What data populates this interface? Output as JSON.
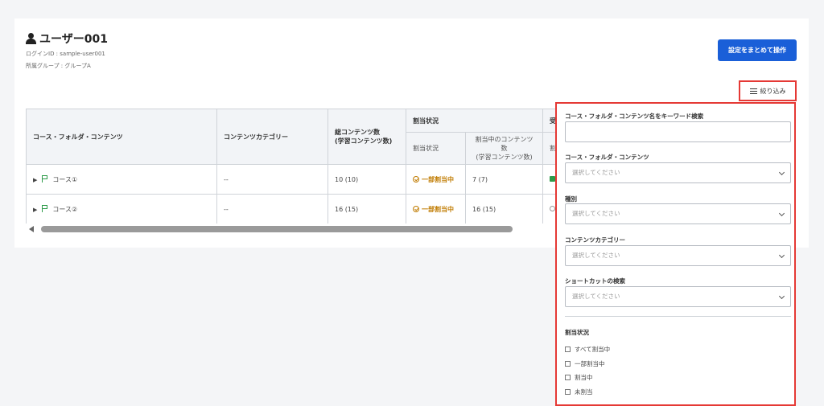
{
  "user": {
    "name": "ユーザー001",
    "login_id": "ログインID : sample-user001",
    "group": "所属グループ : グループA"
  },
  "actions": {
    "bulk_button": "設定をまとめて操作",
    "filter_button": "絞り込み"
  },
  "table": {
    "headers": {
      "course": "コース・フォルダ・コンテンツ",
      "category": "コンテンツカテゴリー",
      "total_line1": "総コンテンツ数",
      "total_line2": "(学習コンテンツ数)",
      "assign_group": "割当状況",
      "assign_status": "割当状況",
      "assigned_line1": "割当中のコンテンツ数",
      "assigned_line2": "(学習コンテンツ数)",
      "next_group": "受",
      "next_sub": "割"
    },
    "rows": [
      {
        "name": "コース①",
        "category": "--",
        "total": "10 (10)",
        "status": "一部割当中",
        "assigned": "7 (7)"
      },
      {
        "name": "コース②",
        "category": "--",
        "total": "16 (15)",
        "status": "一部割当中",
        "assigned": "16 (15)"
      }
    ]
  },
  "filter_panel": {
    "keyword_label": "コース・フォルダ・コンテンツ名をキーワード検索",
    "keyword_value": "",
    "course_label": "コース・フォルダ・コンテンツ",
    "course_placeholder": "選択してください",
    "type_label": "種別",
    "type_placeholder": "選択してください",
    "category_label": "コンテンツカテゴリー",
    "category_placeholder": "選択してください",
    "shortcut_label": "ショートカットの検索",
    "shortcut_placeholder": "選択してください",
    "assign_label": "割当状況",
    "options": [
      "すべて割当中",
      "一部割当中",
      "割当中",
      "未割当"
    ]
  },
  "colors": {
    "primary": "#1a5fd8",
    "highlight": "#e53935",
    "status_partial": "#c07b00",
    "course_flag": "#2e9b4a"
  }
}
